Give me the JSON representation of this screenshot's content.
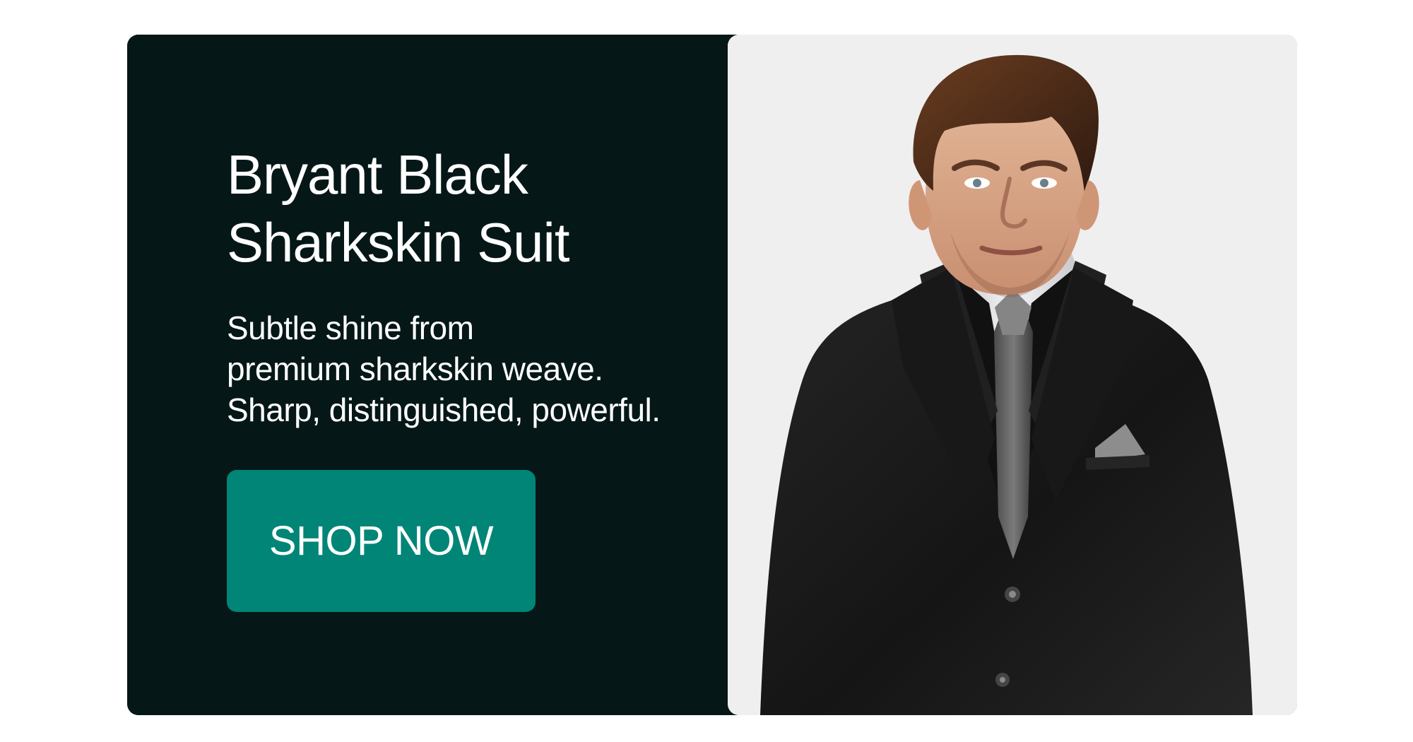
{
  "banner": {
    "headline": {
      "line1": "Bryant Black",
      "line2": "Sharkskin Suit"
    },
    "description": {
      "line1": "Subtle shine from",
      "line2": "premium sharkskin weave.",
      "line3": "Sharp, distinguished, powerful."
    },
    "cta_label": "SHOP NOW",
    "colors": {
      "panel_background": "#061717",
      "button_background": "#008576",
      "image_background": "#efefef",
      "text": "#ffffff"
    },
    "image": {
      "subject": "man-in-black-sharkskin-suit"
    }
  }
}
